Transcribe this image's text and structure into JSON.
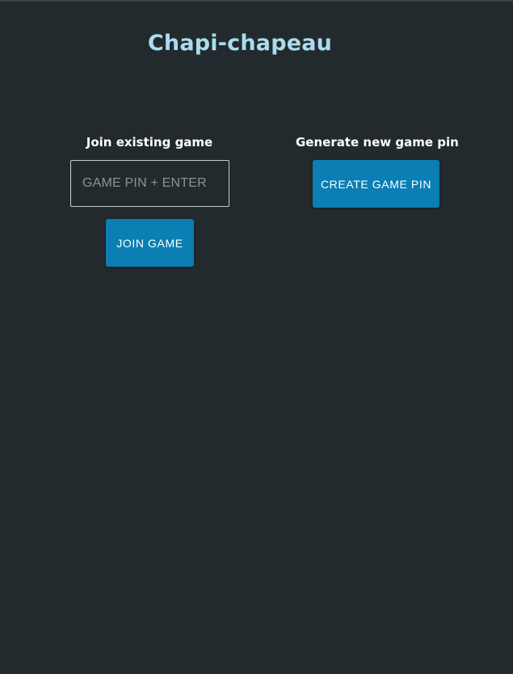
{
  "header": {
    "title": "Chapi-chapeau"
  },
  "join": {
    "heading": "Join existing game",
    "input_placeholder": "GAME PIN + ENTER",
    "input_value": "",
    "button_label": "JOIN GAME"
  },
  "create": {
    "heading": "Generate new game pin",
    "button_label": "CREATE GAME PIN"
  },
  "colors": {
    "background": "#232a2e",
    "title": "#a9dcee",
    "button": "#0b7eb3",
    "heading_text": "#ffffff"
  }
}
